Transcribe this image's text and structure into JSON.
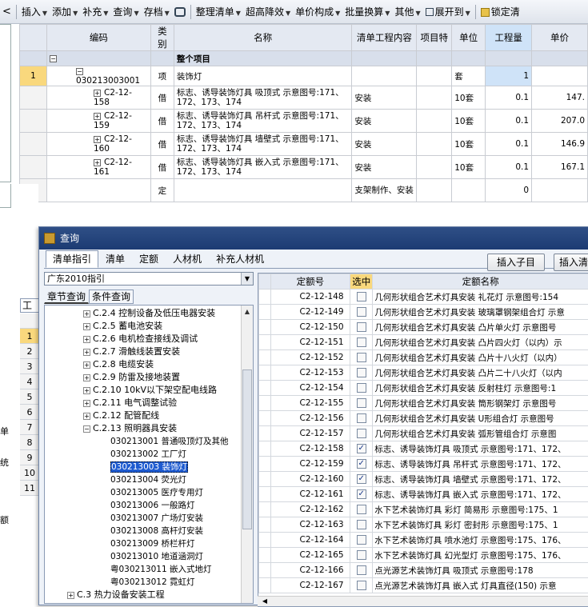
{
  "toolbar": {
    "items": [
      "插入",
      "添加",
      "补充",
      "查询",
      "存档",
      "",
      "整理清单",
      "超高降效",
      "单价构成",
      "批量换算",
      "其他",
      "展开到",
      "锁定清"
    ]
  },
  "main_table": {
    "headers": [
      "编码",
      "类别",
      "名称",
      "清单工程内容",
      "项目特",
      "单位",
      "工程量",
      "单价"
    ],
    "group_row": {
      "name": "整个项目"
    },
    "rows": [
      {
        "num": "1",
        "code": "030213003001",
        "type": "项",
        "name": "装饰灯",
        "content": "",
        "unit": "套",
        "qty": "1",
        "price": ""
      },
      {
        "num": "",
        "code": "C2-12-158",
        "type": "借",
        "name": "标志、诱导装饰灯具 吸顶式 示意图号:171、172、173、174",
        "content": "安装",
        "unit": "10套",
        "qty": "0.1",
        "price": "147."
      },
      {
        "num": "",
        "code": "C2-12-159",
        "type": "借",
        "name": "标志、诱导装饰灯具 吊杆式 示意图号:171、172、173、174",
        "content": "安装",
        "unit": "10套",
        "qty": "0.1",
        "price": "207.0"
      },
      {
        "num": "",
        "code": "C2-12-160",
        "type": "借",
        "name": "标志、诱导装饰灯具 墙壁式 示意图号:171、172、173、174",
        "content": "安装",
        "unit": "10套",
        "qty": "0.1",
        "price": "146.9"
      },
      {
        "num": "",
        "code": "C2-12-161",
        "type": "借",
        "name": "标志、诱导装饰灯具 嵌入式 示意图号:171、172、173、174",
        "content": "安装",
        "unit": "10套",
        "qty": "0.1",
        "price": "167.1"
      },
      {
        "num": "",
        "code": "",
        "type": "定",
        "name": "",
        "content": "支架制作、安装",
        "unit": "",
        "qty": "0",
        "price": ""
      }
    ]
  },
  "outer": {
    "tab_label": "工料",
    "row_numbers": [
      "1",
      "2",
      "3",
      "4",
      "5",
      "6",
      "7",
      "8",
      "9",
      "10",
      "11"
    ],
    "left_chars": [
      "单",
      "统",
      "额"
    ]
  },
  "dialog": {
    "title": "查询",
    "tabs": [
      "清单指引",
      "清单",
      "定额",
      "人材机",
      "补充人材机"
    ],
    "insert_child_button": "插入子目",
    "insert_list_button": "插入清",
    "guide_select": "广东2010指引",
    "subtabs": [
      "章节查询",
      "条件查询"
    ],
    "tree": [
      {
        "label": "C.2.4 控制设备及低压电器安装",
        "kind": "plus"
      },
      {
        "label": "C.2.5 蓄电池安装",
        "kind": "plus"
      },
      {
        "label": "C.2.6 电机检查接线及调试",
        "kind": "plus"
      },
      {
        "label": "C.2.7 滑触线装置安装",
        "kind": "plus"
      },
      {
        "label": "C.2.8 电缆安装",
        "kind": "plus"
      },
      {
        "label": "C.2.9 防雷及接地装置",
        "kind": "plus"
      },
      {
        "label": "C.2.10 10kV以下架空配电线路",
        "kind": "plus"
      },
      {
        "label": "C.2.11 电气调整试验",
        "kind": "plus"
      },
      {
        "label": "C.2.12 配管配线",
        "kind": "plus"
      },
      {
        "label": "C.2.13 照明器具安装",
        "kind": "minus"
      },
      {
        "label": "030213001  普通吸顶灯及其他",
        "kind": "leaf"
      },
      {
        "label": "030213002  工厂灯",
        "kind": "leaf"
      },
      {
        "label": "030213003  装饰灯",
        "kind": "leafsel"
      },
      {
        "label": "030213004  荧光灯",
        "kind": "leaf"
      },
      {
        "label": "030213005  医疗专用灯",
        "kind": "leaf"
      },
      {
        "label": "030213006  一般路灯",
        "kind": "leaf"
      },
      {
        "label": "030213007  广场灯安装",
        "kind": "leaf"
      },
      {
        "label": "030213008  高杆灯安装",
        "kind": "leaf"
      },
      {
        "label": "030213009  桥栏杆灯",
        "kind": "leaf"
      },
      {
        "label": "030213010  地道涵洞灯",
        "kind": "leaf"
      },
      {
        "label": "粤030213011  嵌入式地灯",
        "kind": "leaf"
      },
      {
        "label": "粤030213012  霓虹灯",
        "kind": "leaf"
      },
      {
        "label": "C.3 热力设备安装工程",
        "kind": "plustop"
      }
    ],
    "grid_headers": [
      "定额号",
      "选中",
      "定额名称"
    ],
    "grid_rows": [
      {
        "code": "C2-12-148",
        "checked": false,
        "name": "几何形状组合艺术灯具安装 礼花灯 示意图号:154"
      },
      {
        "code": "C2-12-149",
        "checked": false,
        "name": "几何形状组合艺术灯具安装 玻璃罩钢架组合灯 示意"
      },
      {
        "code": "C2-12-150",
        "checked": false,
        "name": "几何形状组合艺术灯具安装 凸片单火灯 示意图号"
      },
      {
        "code": "C2-12-151",
        "checked": false,
        "name": "几何形状组合艺术灯具安装 凸片四火灯（以内）示"
      },
      {
        "code": "C2-12-152",
        "checked": false,
        "name": "几何形状组合艺术灯具安装 凸片十八火灯（以内）"
      },
      {
        "code": "C2-12-153",
        "checked": false,
        "name": "几何形状组合艺术灯具安装 凸片二十八火灯（以内"
      },
      {
        "code": "C2-12-154",
        "checked": false,
        "name": "几何形状组合艺术灯具安装 反射柱灯 示意图号:1"
      },
      {
        "code": "C2-12-155",
        "checked": false,
        "name": "几何形状组合艺术灯具安装 筒形钢架灯 示意图号"
      },
      {
        "code": "C2-12-156",
        "checked": false,
        "name": "几何形状组合艺术灯具安装 U形组合灯 示意图号"
      },
      {
        "code": "C2-12-157",
        "checked": false,
        "name": "几何形状组合艺术灯具安装 弧形管组合灯 示意图"
      },
      {
        "code": "C2-12-158",
        "checked": true,
        "name": "标志、诱导装饰灯具 吸顶式 示意图号:171、172、"
      },
      {
        "code": "C2-12-159",
        "checked": true,
        "name": "标志、诱导装饰灯具 吊杆式 示意图号:171、172、"
      },
      {
        "code": "C2-12-160",
        "checked": true,
        "name": "标志、诱导装饰灯具 墙壁式 示意图号:171、172、"
      },
      {
        "code": "C2-12-161",
        "checked": true,
        "name": "标志、诱导装饰灯具 嵌入式 示意图号:171、172、"
      },
      {
        "code": "C2-12-162",
        "checked": false,
        "name": "水下艺术装饰灯具 彩灯 简易形 示意图号:175、1"
      },
      {
        "code": "C2-12-163",
        "checked": false,
        "name": "水下艺术装饰灯具 彩灯 密封形 示意图号:175、1"
      },
      {
        "code": "C2-12-164",
        "checked": false,
        "name": "水下艺术装饰灯具 喷水池灯 示意图号:175、176、"
      },
      {
        "code": "C2-12-165",
        "checked": false,
        "name": "水下艺术装饰灯具 幻光型灯 示意图号:175、176、"
      },
      {
        "code": "C2-12-166",
        "checked": false,
        "name": "点光源艺术装饰灯具 吸顶式  示意图号:178"
      },
      {
        "code": "C2-12-167",
        "checked": false,
        "name": "点光源艺术装饰灯具 嵌入式 灯具直径(150) 示意"
      }
    ]
  }
}
